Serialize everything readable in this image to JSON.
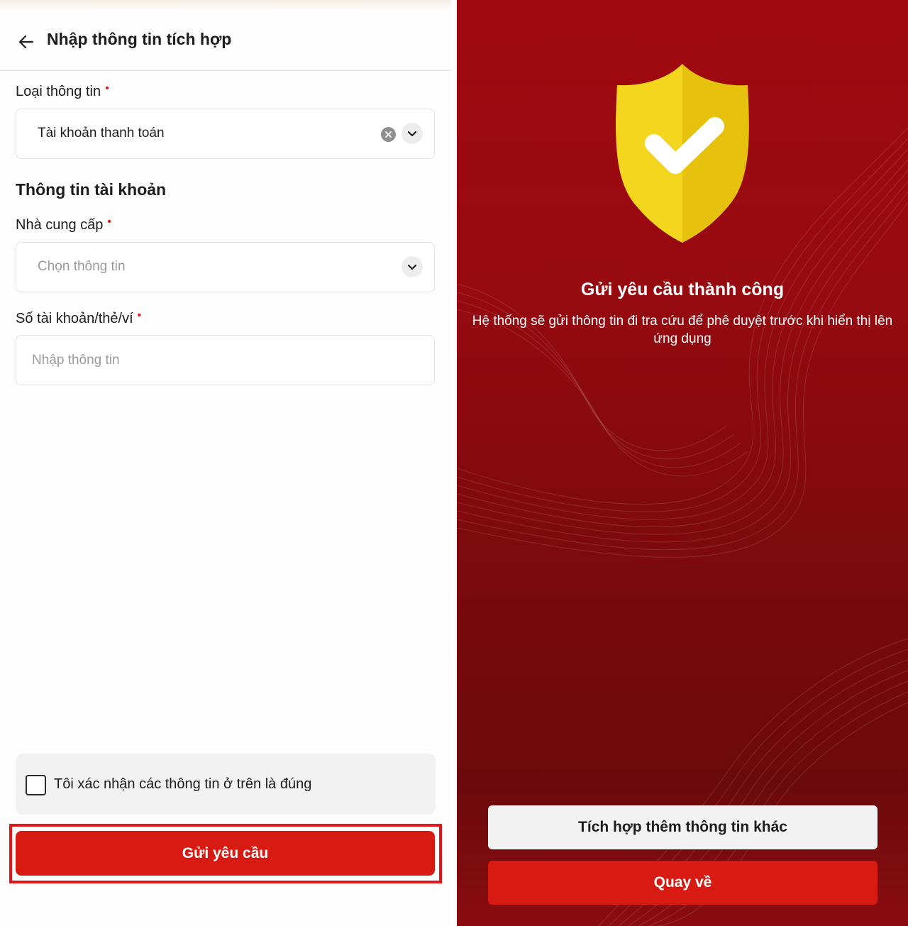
{
  "form": {
    "title": "Nhập thông tin tích hợp",
    "type_label": "Loại thông tin",
    "type_value": "Tài khoản thanh toán",
    "section_title": "Thông tin tài khoản",
    "provider_label": "Nhà cung cấp",
    "provider_placeholder": "Chọn thông tin",
    "account_label": "Số tài khoản/thẻ/ví",
    "account_placeholder": "Nhập thông tin",
    "required_mark": "•",
    "confirm_label": "Tôi xác nhận các thông tin ở trên là đúng",
    "confirm_checked": false,
    "submit_label": "Gửi yêu cầu",
    "accent_color": "#d71a12",
    "highlight_color": "#e0161a"
  },
  "success": {
    "title": "Gửi yêu cầu thành công",
    "description": "Hệ thống sẽ gửi thông tin đi tra cứu để phê duyệt trước khi hiển thị lên ứng dụng",
    "icon": "shield-check-icon",
    "more_button_label": "Tích hợp thêm thông tin khác",
    "back_button_label": "Quay về",
    "background_color": "#970a10"
  }
}
